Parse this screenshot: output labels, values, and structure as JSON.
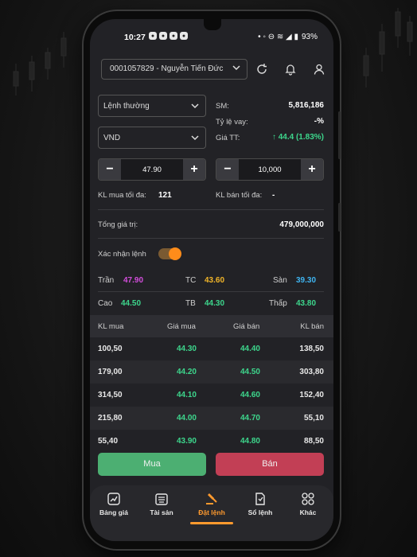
{
  "colors": {
    "accent": "#ff9a2e",
    "up": "#3dd68c",
    "ceiling": "#d24ddb",
    "reference": "#f0b429",
    "floor": "#3fb4f0",
    "buy": "#4caf72",
    "sell": "#c23f55"
  },
  "status_bar": {
    "time": "10:27",
    "battery": "93%"
  },
  "header": {
    "account": "0001057829 - Nguyễn Tiến Đức",
    "icons": [
      "refresh-icon",
      "bell-icon",
      "user-icon"
    ]
  },
  "order_form": {
    "order_type": "Lệnh thường",
    "currency": "VND",
    "sm_label": "SM:",
    "sm_value": "5,816,186",
    "loan_ratio_label": "Tỷ lệ vay:",
    "loan_ratio_value": "-%",
    "market_price_label": "Giá TT:",
    "market_price_value": "44.4 (1.83%)",
    "price": "47.90",
    "quantity": "10,000",
    "max_buy_label": "KL mua tối đa:",
    "max_buy_value": "121",
    "max_sell_label": "KL bán tối đa:",
    "max_sell_value": "-",
    "total_label": "Tổng giá trị:",
    "total_value": "479,000,000",
    "confirm_label": "Xác nhận lệnh",
    "confirm_enabled": true
  },
  "price_info": {
    "ceiling_label": "Trần",
    "ceiling": "47.90",
    "ref_label": "TC",
    "ref": "43.60",
    "floor_label": "Sàn",
    "floor": "39.30",
    "high_label": "Cao",
    "high": "44.50",
    "avg_label": "TB",
    "avg": "44.30",
    "low_label": "Thấp",
    "low": "43.80"
  },
  "order_book": {
    "headers": [
      "KL mua",
      "Giá mua",
      "Giá bán",
      "KL bán"
    ],
    "rows": [
      [
        "100,50",
        "44.30",
        "44.40",
        "138,50"
      ],
      [
        "179,00",
        "44.20",
        "44.50",
        "303,80"
      ],
      [
        "314,50",
        "44.10",
        "44.60",
        "152,40"
      ],
      [
        "215,80",
        "44.00",
        "44.70",
        "55,10"
      ],
      [
        "55,40",
        "43.90",
        "44.80",
        "88,50"
      ]
    ]
  },
  "actions": {
    "buy": "Mua",
    "sell": "Bán"
  },
  "nav": [
    {
      "label": "Bảng giá",
      "icon": "chart-icon"
    },
    {
      "label": "Tài sản",
      "icon": "wallet-icon"
    },
    {
      "label": "Đặt lệnh",
      "icon": "gavel-icon",
      "active": true
    },
    {
      "label": "Sổ lệnh",
      "icon": "orderbook-icon"
    },
    {
      "label": "Khác",
      "icon": "grid-icon"
    }
  ]
}
